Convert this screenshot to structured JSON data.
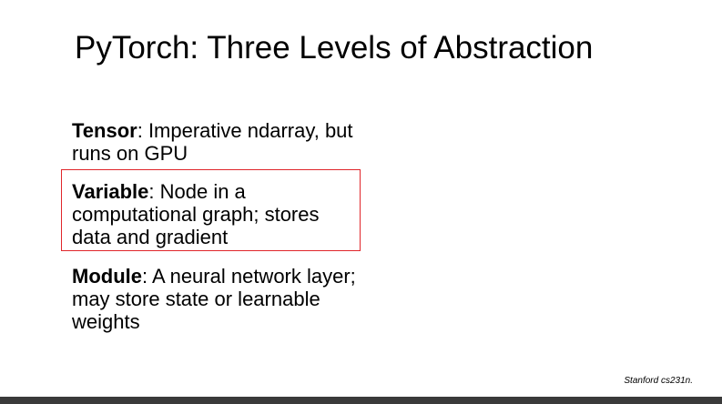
{
  "slide": {
    "title": "PyTorch: Three Levels of Abstraction",
    "items": [
      {
        "term": "Tensor",
        "description": ": Imperative ndarray, but runs on GPU"
      },
      {
        "term": "Variable",
        "description": ": Node in a computational graph; stores data and gradient",
        "highlighted": true
      },
      {
        "term": "Module",
        "description": ": A neural network layer; may store state or learnable weights"
      }
    ],
    "credit": "Stanford cs231n."
  },
  "colors": {
    "highlight_border": "#e0262b",
    "bottom_bar": "#3a3a3a"
  }
}
